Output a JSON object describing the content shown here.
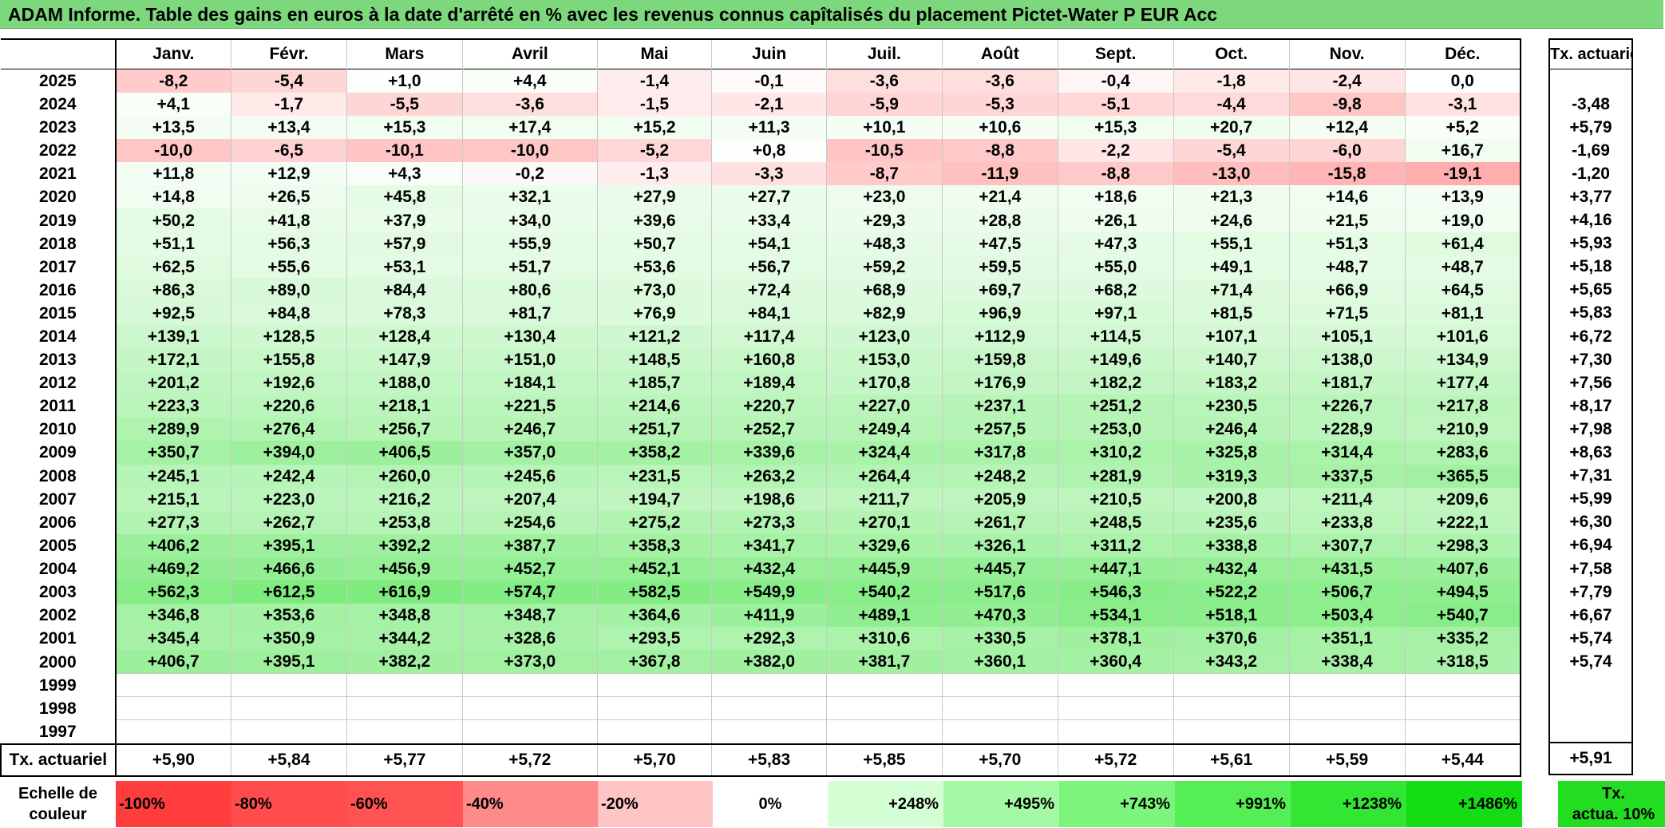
{
  "title": "ADAM Informe. Table des gains en euros à la date d'arrêté en % avec les revenus connus capîtalisés du placement Pictet-Water P EUR Acc",
  "side_header": "Tx. actuariel",
  "chart_data": {
    "type": "table",
    "columns": [
      "Janv.",
      "Févr.",
      "Mars",
      "Avril",
      "Mai",
      "Juin",
      "Juil.",
      "Août",
      "Sept.",
      "Oct.",
      "Nov.",
      "Déc."
    ],
    "rows": [
      {
        "year": "2025",
        "values": [
          "-8,2",
          "-5,4",
          "+1,0",
          "+4,4",
          "-1,4",
          "-0,1",
          "-3,6",
          "-3,6",
          "-0,4",
          "-1,8",
          "-2,4",
          "0,0"
        ],
        "rate": ""
      },
      {
        "year": "2024",
        "values": [
          "+4,1",
          "-1,7",
          "-5,5",
          "-3,6",
          "-1,5",
          "-2,1",
          "-5,9",
          "-5,3",
          "-5,1",
          "-4,4",
          "-9,8",
          "-3,1"
        ],
        "rate": "-3,48"
      },
      {
        "year": "2023",
        "values": [
          "+13,5",
          "+13,4",
          "+15,3",
          "+17,4",
          "+15,2",
          "+11,3",
          "+10,1",
          "+10,6",
          "+15,3",
          "+20,7",
          "+12,4",
          "+5,2"
        ],
        "rate": "+5,79"
      },
      {
        "year": "2022",
        "values": [
          "-10,0",
          "-6,5",
          "-10,1",
          "-10,0",
          "-5,2",
          "+0,8",
          "-10,5",
          "-8,8",
          "-2,2",
          "-5,4",
          "-6,0",
          "+16,7"
        ],
        "rate": "-1,69"
      },
      {
        "year": "2021",
        "values": [
          "+11,8",
          "+12,9",
          "+4,3",
          "-0,2",
          "-1,3",
          "-3,3",
          "-8,7",
          "-11,9",
          "-8,8",
          "-13,0",
          "-15,8",
          "-19,1"
        ],
        "rate": "-1,20"
      },
      {
        "year": "2020",
        "values": [
          "+14,8",
          "+26,5",
          "+45,8",
          "+32,1",
          "+27,9",
          "+27,7",
          "+23,0",
          "+21,4",
          "+18,6",
          "+21,3",
          "+14,6",
          "+13,9"
        ],
        "rate": "+3,77"
      },
      {
        "year": "2019",
        "values": [
          "+50,2",
          "+41,8",
          "+37,9",
          "+34,0",
          "+39,6",
          "+33,4",
          "+29,3",
          "+28,8",
          "+26,1",
          "+24,6",
          "+21,5",
          "+19,0"
        ],
        "rate": "+4,16"
      },
      {
        "year": "2018",
        "values": [
          "+51,1",
          "+56,3",
          "+57,9",
          "+55,9",
          "+50,7",
          "+54,1",
          "+48,3",
          "+47,5",
          "+47,3",
          "+55,1",
          "+51,3",
          "+61,4"
        ],
        "rate": "+5,93"
      },
      {
        "year": "2017",
        "values": [
          "+62,5",
          "+55,6",
          "+53,1",
          "+51,7",
          "+53,6",
          "+56,7",
          "+59,2",
          "+59,5",
          "+55,0",
          "+49,1",
          "+48,7",
          "+48,7"
        ],
        "rate": "+5,18"
      },
      {
        "year": "2016",
        "values": [
          "+86,3",
          "+89,0",
          "+84,4",
          "+80,6",
          "+73,0",
          "+72,4",
          "+68,9",
          "+69,7",
          "+68,2",
          "+71,4",
          "+66,9",
          "+64,5"
        ],
        "rate": "+5,65"
      },
      {
        "year": "2015",
        "values": [
          "+92,5",
          "+84,8",
          "+78,3",
          "+81,7",
          "+76,9",
          "+84,1",
          "+82,9",
          "+96,9",
          "+97,1",
          "+81,5",
          "+71,5",
          "+81,1"
        ],
        "rate": "+5,83"
      },
      {
        "year": "2014",
        "values": [
          "+139,1",
          "+128,5",
          "+128,4",
          "+130,4",
          "+121,2",
          "+117,4",
          "+123,0",
          "+112,9",
          "+114,5",
          "+107,1",
          "+105,1",
          "+101,6"
        ],
        "rate": "+6,72"
      },
      {
        "year": "2013",
        "values": [
          "+172,1",
          "+155,8",
          "+147,9",
          "+151,0",
          "+148,5",
          "+160,8",
          "+153,0",
          "+159,8",
          "+149,6",
          "+140,7",
          "+138,0",
          "+134,9"
        ],
        "rate": "+7,30"
      },
      {
        "year": "2012",
        "values": [
          "+201,2",
          "+192,6",
          "+188,0",
          "+184,1",
          "+185,7",
          "+189,4",
          "+170,8",
          "+176,9",
          "+182,2",
          "+183,2",
          "+181,7",
          "+177,4"
        ],
        "rate": "+7,56"
      },
      {
        "year": "2011",
        "values": [
          "+223,3",
          "+220,6",
          "+218,1",
          "+221,5",
          "+214,6",
          "+220,7",
          "+227,0",
          "+237,1",
          "+251,2",
          "+230,5",
          "+226,7",
          "+217,8"
        ],
        "rate": "+8,17"
      },
      {
        "year": "2010",
        "values": [
          "+289,9",
          "+276,4",
          "+256,7",
          "+246,7",
          "+251,7",
          "+252,7",
          "+249,4",
          "+257,5",
          "+253,0",
          "+246,4",
          "+228,9",
          "+210,9"
        ],
        "rate": "+7,98"
      },
      {
        "year": "2009",
        "values": [
          "+350,7",
          "+394,0",
          "+406,5",
          "+357,0",
          "+358,2",
          "+339,6",
          "+324,4",
          "+317,8",
          "+310,2",
          "+325,8",
          "+314,4",
          "+283,6"
        ],
        "rate": "+8,63"
      },
      {
        "year": "2008",
        "values": [
          "+245,1",
          "+242,4",
          "+260,0",
          "+245,6",
          "+231,5",
          "+263,2",
          "+264,4",
          "+248,2",
          "+281,9",
          "+319,3",
          "+337,5",
          "+365,5"
        ],
        "rate": "+7,31"
      },
      {
        "year": "2007",
        "values": [
          "+215,1",
          "+223,0",
          "+216,2",
          "+207,4",
          "+194,7",
          "+198,6",
          "+211,7",
          "+205,9",
          "+210,5",
          "+200,8",
          "+211,4",
          "+209,6"
        ],
        "rate": "+5,99"
      },
      {
        "year": "2006",
        "values": [
          "+277,3",
          "+262,7",
          "+253,8",
          "+254,6",
          "+275,2",
          "+273,3",
          "+270,1",
          "+261,7",
          "+248,5",
          "+235,6",
          "+233,8",
          "+222,1"
        ],
        "rate": "+6,30"
      },
      {
        "year": "2005",
        "values": [
          "+406,2",
          "+395,1",
          "+392,2",
          "+387,7",
          "+358,3",
          "+341,7",
          "+329,6",
          "+326,1",
          "+311,2",
          "+338,8",
          "+307,7",
          "+298,3"
        ],
        "rate": "+6,94"
      },
      {
        "year": "2004",
        "values": [
          "+469,2",
          "+466,6",
          "+456,9",
          "+452,7",
          "+452,1",
          "+432,4",
          "+445,9",
          "+445,7",
          "+447,1",
          "+432,4",
          "+431,5",
          "+407,6"
        ],
        "rate": "+7,58"
      },
      {
        "year": "2003",
        "values": [
          "+562,3",
          "+612,5",
          "+616,9",
          "+574,7",
          "+582,5",
          "+549,9",
          "+540,2",
          "+517,6",
          "+546,3",
          "+522,2",
          "+506,7",
          "+494,5"
        ],
        "rate": "+7,79"
      },
      {
        "year": "2002",
        "values": [
          "+346,8",
          "+353,6",
          "+348,8",
          "+348,7",
          "+364,6",
          "+411,9",
          "+489,1",
          "+470,3",
          "+534,1",
          "+518,1",
          "+503,4",
          "+540,7"
        ],
        "rate": "+6,67"
      },
      {
        "year": "2001",
        "values": [
          "+345,4",
          "+350,9",
          "+344,2",
          "+328,6",
          "+293,5",
          "+292,3",
          "+310,6",
          "+330,5",
          "+378,1",
          "+370,6",
          "+351,1",
          "+335,2"
        ],
        "rate": "+5,74"
      },
      {
        "year": "2000",
        "values": [
          "+406,7",
          "+395,1",
          "+382,2",
          "+373,0",
          "+367,8",
          "+382,0",
          "+381,7",
          "+360,1",
          "+360,4",
          "+343,2",
          "+338,4",
          "+318,5"
        ],
        "rate": "+5,74"
      },
      {
        "year": "1999",
        "values": [
          "",
          "",
          "",
          "",
          "",
          "",
          "",
          "",
          "",
          "",
          "",
          ""
        ],
        "rate": ""
      },
      {
        "year": "1998",
        "values": [
          "",
          "",
          "",
          "",
          "",
          "",
          "",
          "",
          "",
          "",
          "",
          ""
        ],
        "rate": ""
      },
      {
        "year": "1997",
        "values": [
          "",
          "",
          "",
          "",
          "",
          "",
          "",
          "",
          "",
          "",
          "",
          ""
        ],
        "rate": ""
      }
    ],
    "summary": {
      "label": "Tx. actuariel",
      "values": [
        "+5,90",
        "+5,84",
        "+5,77",
        "+5,72",
        "+5,70",
        "+5,83",
        "+5,85",
        "+5,70",
        "+5,72",
        "+5,61",
        "+5,59",
        "+5,44"
      ],
      "total": "+5,91"
    },
    "color_scale": {
      "label_line1": "Echelle de",
      "label_line2": "couleur",
      "min_negative": -100,
      "max_positive": 1486,
      "negative_color": "#ff3333",
      "positive_color": "#22dd22",
      "steps": [
        {
          "label": "-100%",
          "color": "#ff3d3d"
        },
        {
          "label": "-80%",
          "color": "#ff4d4d"
        },
        {
          "label": "-60%",
          "color": "#ff5252"
        },
        {
          "label": "-40%",
          "color": "#ff8a8a"
        },
        {
          "label": "-20%",
          "color": "#ffc4c4"
        },
        {
          "label": "0%",
          "color": "#ffffff"
        },
        {
          "label": "+248%",
          "color": "#d4ffd4"
        },
        {
          "label": "+495%",
          "color": "#a4f9a4"
        },
        {
          "label": "+743%",
          "color": "#7df57d"
        },
        {
          "label": "+991%",
          "color": "#55ee55"
        },
        {
          "label": "+1238%",
          "color": "#33e633"
        },
        {
          "label": "+1486%",
          "color": "#14dd14"
        }
      ],
      "rate_label_line1": "Tx.",
      "rate_label_line2": "actua. 10%"
    }
  }
}
